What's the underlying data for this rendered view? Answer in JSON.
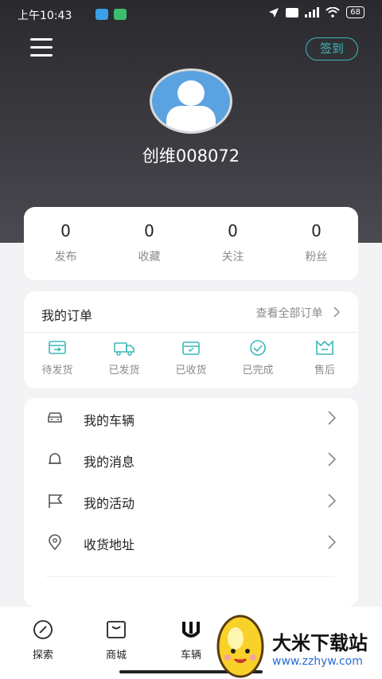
{
  "status": {
    "time": "上午10:43",
    "battery": "68"
  },
  "header": {
    "signin_label": "签到",
    "username": "创维008072"
  },
  "stats": [
    {
      "value": "0",
      "label": "发布"
    },
    {
      "value": "0",
      "label": "收藏"
    },
    {
      "value": "0",
      "label": "关注"
    },
    {
      "value": "0",
      "label": "粉丝"
    }
  ],
  "orders": {
    "title": "我的订单",
    "more_label": "查看全部订单",
    "items": [
      {
        "label": "待发货",
        "icon": "pending-ship-icon"
      },
      {
        "label": "已发货",
        "icon": "shipped-truck-icon"
      },
      {
        "label": "已收货",
        "icon": "received-box-icon"
      },
      {
        "label": "已完成",
        "icon": "completed-check-icon"
      },
      {
        "label": "售后",
        "icon": "after-sale-icon"
      }
    ]
  },
  "menu": [
    {
      "label": "我的车辆",
      "icon": "car-icon"
    },
    {
      "label": "我的消息",
      "icon": "bell-icon"
    },
    {
      "label": "我的活动",
      "icon": "flag-icon"
    },
    {
      "label": "收货地址",
      "icon": "location-icon"
    }
  ],
  "tabbar": [
    {
      "label": "探索",
      "icon": "compass-icon"
    },
    {
      "label": "商城",
      "icon": "shop-icon"
    },
    {
      "label": "车辆",
      "icon": "vehicle-brand-icon"
    }
  ],
  "watermark": {
    "cn": "大米下载站",
    "en": "www.zzhyw.com"
  },
  "colors": {
    "accent": "#3fb7b9",
    "header_dark": "#2a2a2e"
  }
}
